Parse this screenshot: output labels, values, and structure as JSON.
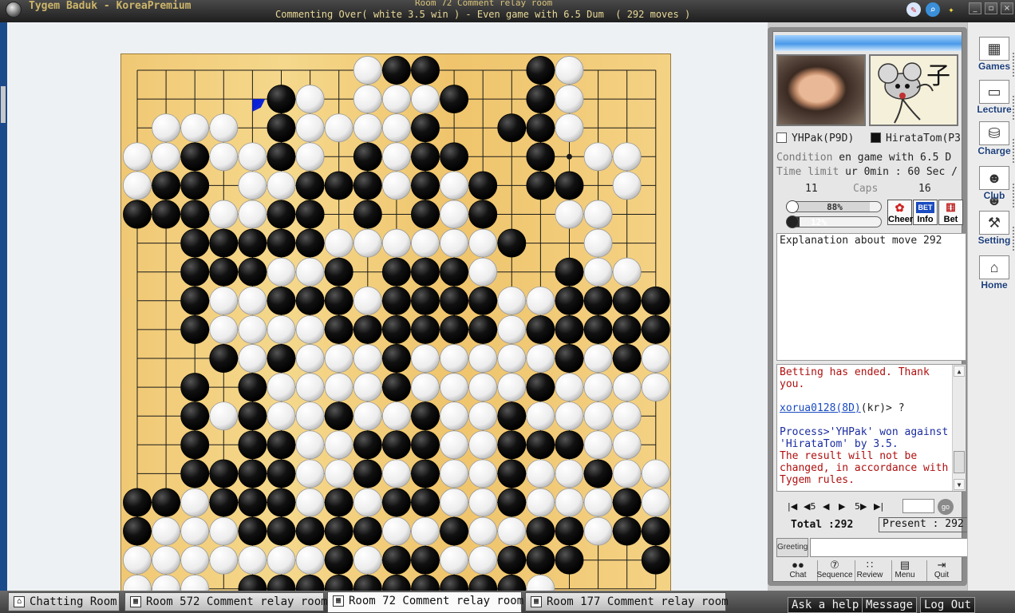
{
  "window": {
    "title": "Tygem Baduk - KoreaPremium",
    "room_line": "Room 72 Comment relay room",
    "status": "Commenting Over( white 3.5 win ) - Even game with 6.5 Dum  ( 292 moves )"
  },
  "board": {
    "size": 19,
    "rows": [
      "........WBB...BW...",
      ".....BW.WWWB..BW...",
      ".WWW.BWWWWB..BBW...",
      "WWBWWBW.BWBB..B.WW.",
      "WBB.WWBBBWBWB.BB.W.",
      "BBBWWBB.B.BWB..WW..",
      "..BBBBBWWWWWWB..W..",
      "..BBBWWB.BBBW..BWW.",
      "..BWWBBBWBBBBWWBBBB",
      "..BWWWWBBBBBBWBBBBB",
      "...BWBWWWBWWWWWBWBW",
      "..B.BWWWWBWWWWBWWWW",
      "..BWBWWBWWBWWBWWWW.",
      "..B.BBWWBBBWWBBBWW.",
      "..BBBBWWBWBWWBWWBWW",
      "BBWBBBWBWBBWWBWWWBW",
      "BWWWBBBBBWWBWWBBWBB",
      "WWWWWWWBWBBWWBBB..B",
      "WWW.BBBBBBBBBBW...."
    ],
    "last_move": {
      "row": 1,
      "col": 4,
      "color": "W"
    },
    "colors": {
      "board": "#f4d386",
      "line": "#1a1a1a",
      "marker": "#0a1fd8"
    }
  },
  "players": {
    "white": {
      "name": "YHPak(P9D)",
      "caps": "11"
    },
    "black": {
      "name": "HirataTom(P3",
      "caps": "16",
      "badge_char": "子"
    }
  },
  "info": {
    "condition_label": "Condition",
    "condition_value": "en game with 6.5 D",
    "time_label": "Time limit",
    "time_value": "ur 0min : 60 Sec /",
    "caps_label": "Caps",
    "white_bar_text": "88%",
    "white_bar_fill": 0.88,
    "black_bar_text": "12%",
    "black_bar_fill": 0.12,
    "buttons": [
      {
        "label": "Cheer",
        "icon": "cheer-icon"
      },
      {
        "label": "Info",
        "icon": "bet-info-icon",
        "badge": "BET"
      },
      {
        "label": "Bet",
        "icon": "bet-dice-icon"
      }
    ]
  },
  "explanation": "Explanation about move 292",
  "chat": [
    {
      "text": "Betting has ended. Thank\nyou.",
      "color": "#b01010"
    },
    {
      "text": "",
      "color": "#000"
    },
    {
      "user": "xorua0128(8D)",
      "text": "(kr)> ?",
      "color": "#222"
    },
    {
      "text": "",
      "color": "#000"
    },
    {
      "text": "Process>'YHPak' won against\n'HirataTom' by 3.5.",
      "color": "#1a2ca0"
    },
    {
      "text": "The result will not be\nchanged, in accordance with\nTygem rules.",
      "color": "#b01010"
    }
  ],
  "nav": {
    "buttons": [
      "|◀",
      "◀5",
      "◀",
      "▶",
      "5▶",
      "▶|"
    ],
    "go_label": "go",
    "total": "Total :292",
    "present": "Present : 292"
  },
  "greeting": {
    "label": "Greeting"
  },
  "tools": [
    {
      "label": "Chat",
      "icon": "chat-icon",
      "glyph": "●●"
    },
    {
      "label": "Sequence",
      "icon": "sequence-icon",
      "glyph": "⑦"
    },
    {
      "label": "Review",
      "icon": "review-icon",
      "glyph": "∷"
    },
    {
      "label": "Menu",
      "icon": "menu-icon",
      "glyph": "▤"
    },
    {
      "label": "Quit",
      "icon": "quit-icon",
      "glyph": "⇥"
    }
  ],
  "right_menu": [
    {
      "label": "Games",
      "icon": "games-icon",
      "glyph": "▦"
    },
    {
      "label": "Lecture",
      "icon": "lecture-icon",
      "glyph": "▭"
    },
    {
      "label": "Charge",
      "icon": "charge-icon",
      "glyph": "⛁"
    },
    {
      "label": "Club",
      "icon": "club-icon",
      "glyph": "☻☻"
    },
    {
      "label": "Setting",
      "icon": "setting-icon",
      "glyph": "⚒"
    },
    {
      "label": "Home",
      "icon": "home-icon",
      "glyph": "⌂"
    }
  ],
  "tabs": [
    {
      "label": "Chatting Room",
      "icon": "house-icon",
      "glyph": "⌂",
      "active": false
    },
    {
      "label": "Room 572 Comment relay room",
      "icon": "board-icon",
      "glyph": "▦",
      "active": false
    },
    {
      "label": "Room 72 Comment relay room",
      "icon": "board-icon",
      "glyph": "▦",
      "active": true
    },
    {
      "label": "Room 177 Comment relay room",
      "icon": "board-icon",
      "glyph": "▦",
      "active": false
    }
  ],
  "footer_buttons": [
    "Ask a help",
    "Message",
    "Log Out"
  ]
}
